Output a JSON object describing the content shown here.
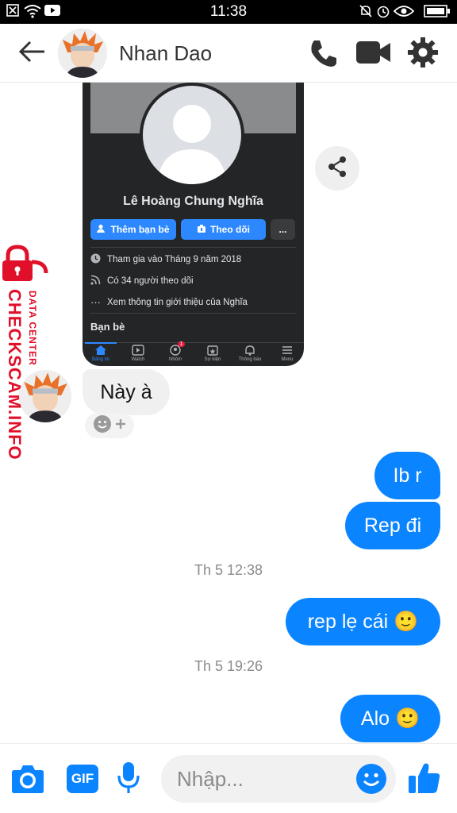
{
  "status_bar": {
    "time": "11:38"
  },
  "header": {
    "contact_name": "Nhan Dao"
  },
  "fb_profile": {
    "name": "Lê Hoàng Chung Nghĩa",
    "add_friend_label": "Thêm bạn bè",
    "follow_label": "Theo dõi",
    "more_label": "...",
    "joined": "Tham gia vào Tháng 9 năm 2018",
    "followers": "Có 34 người theo dõi",
    "about": "Xem thông tin giới thiệu của Nghĩa",
    "friends_heading": "Bạn bè",
    "tabs": [
      "Bảng tin",
      "Watch",
      "Nhóm",
      "Sự kiện",
      "Thông báo",
      "Menu"
    ],
    "groups_badge": "1"
  },
  "messages": {
    "in_1": "Này à",
    "out_1": "Ib r",
    "out_2": "Rep đi",
    "time_1": "Th 5 12:38",
    "out_3": "rep lẹ cái 🙂",
    "time_2": "Th 5 19:26",
    "out_4": "Alo 🙂"
  },
  "composer": {
    "placeholder": "Nhập...",
    "gif_label": "GIF"
  },
  "watermark": {
    "brand": "CHECKSCAM.INFO",
    "tag": "DATA CENTER"
  },
  "colors": {
    "accent": "#0a84ff",
    "watermark": "#e0102a"
  }
}
